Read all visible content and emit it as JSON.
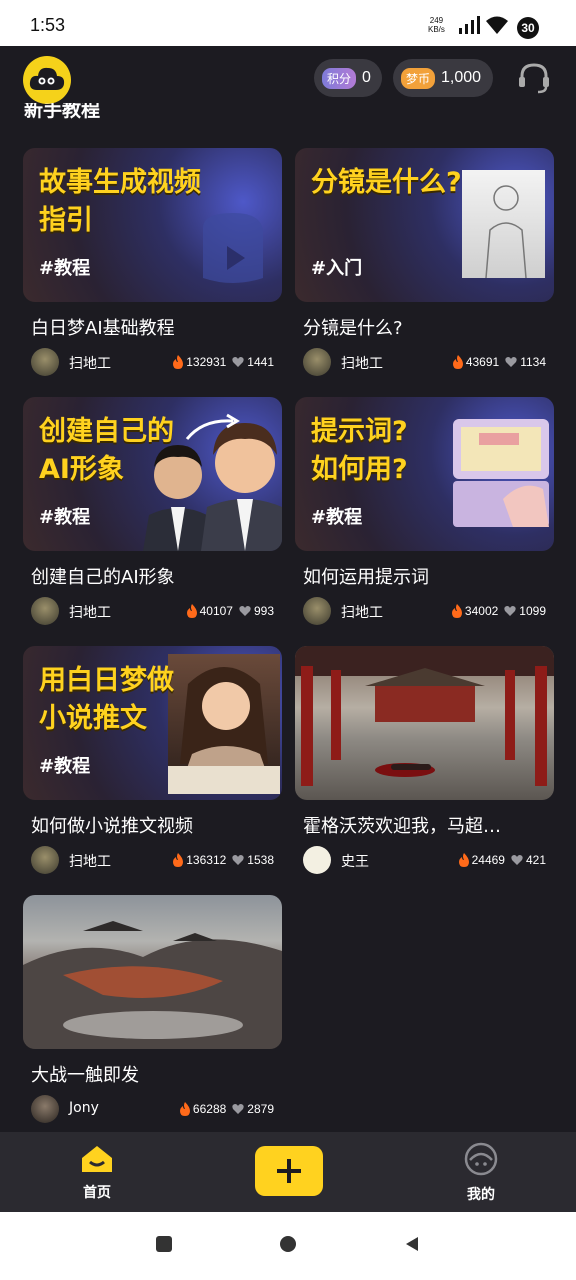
{
  "status": {
    "time": "1:53",
    "net_speed": "249",
    "net_unit": "KB/s",
    "battery": "30"
  },
  "header": {
    "points_label": "积分",
    "points_value": "0",
    "coins_label": "梦币",
    "coins_value": "1,000"
  },
  "section_title": "新手教程",
  "cards": [
    {
      "thumb_title": "故事生成视频\n指引",
      "thumb_tag": "#教程",
      "title": "白日梦AI基础教程",
      "author": "扫地工",
      "views": "132931",
      "likes": "1441"
    },
    {
      "thumb_title": "分镜是什么?",
      "thumb_tag": "#入门",
      "title": "分镜是什么?",
      "author": "扫地工",
      "views": "43691",
      "likes": "1134"
    },
    {
      "thumb_title": "创建自己的\nAI形象",
      "thumb_tag": "#教程",
      "title": "创建自己的AI形象",
      "author": "扫地工",
      "views": "40107",
      "likes": "993"
    },
    {
      "thumb_title": "提示词?\n如何用?",
      "thumb_tag": "#教程",
      "title": "如何运用提示词",
      "author": "扫地工",
      "views": "34002",
      "likes": "1099"
    },
    {
      "thumb_title": "用白日梦做\n小说推文",
      "thumb_tag": "#教程",
      "title": "如何做小说推文视频",
      "author": "扫地工",
      "views": "136312",
      "likes": "1538"
    },
    {
      "title": "霍格沃茨欢迎我，马超…",
      "author": "史王",
      "views": "24469",
      "likes": "421"
    },
    {
      "title": "大战一触即发",
      "author": "Jony",
      "views": "66288",
      "likes": "2879"
    }
  ],
  "nav": {
    "home_label": "首页",
    "me_label": "我的"
  },
  "colors": {
    "accent": "#ffd21f",
    "background": "#1c1b21",
    "fire": "#ff6a1a"
  }
}
